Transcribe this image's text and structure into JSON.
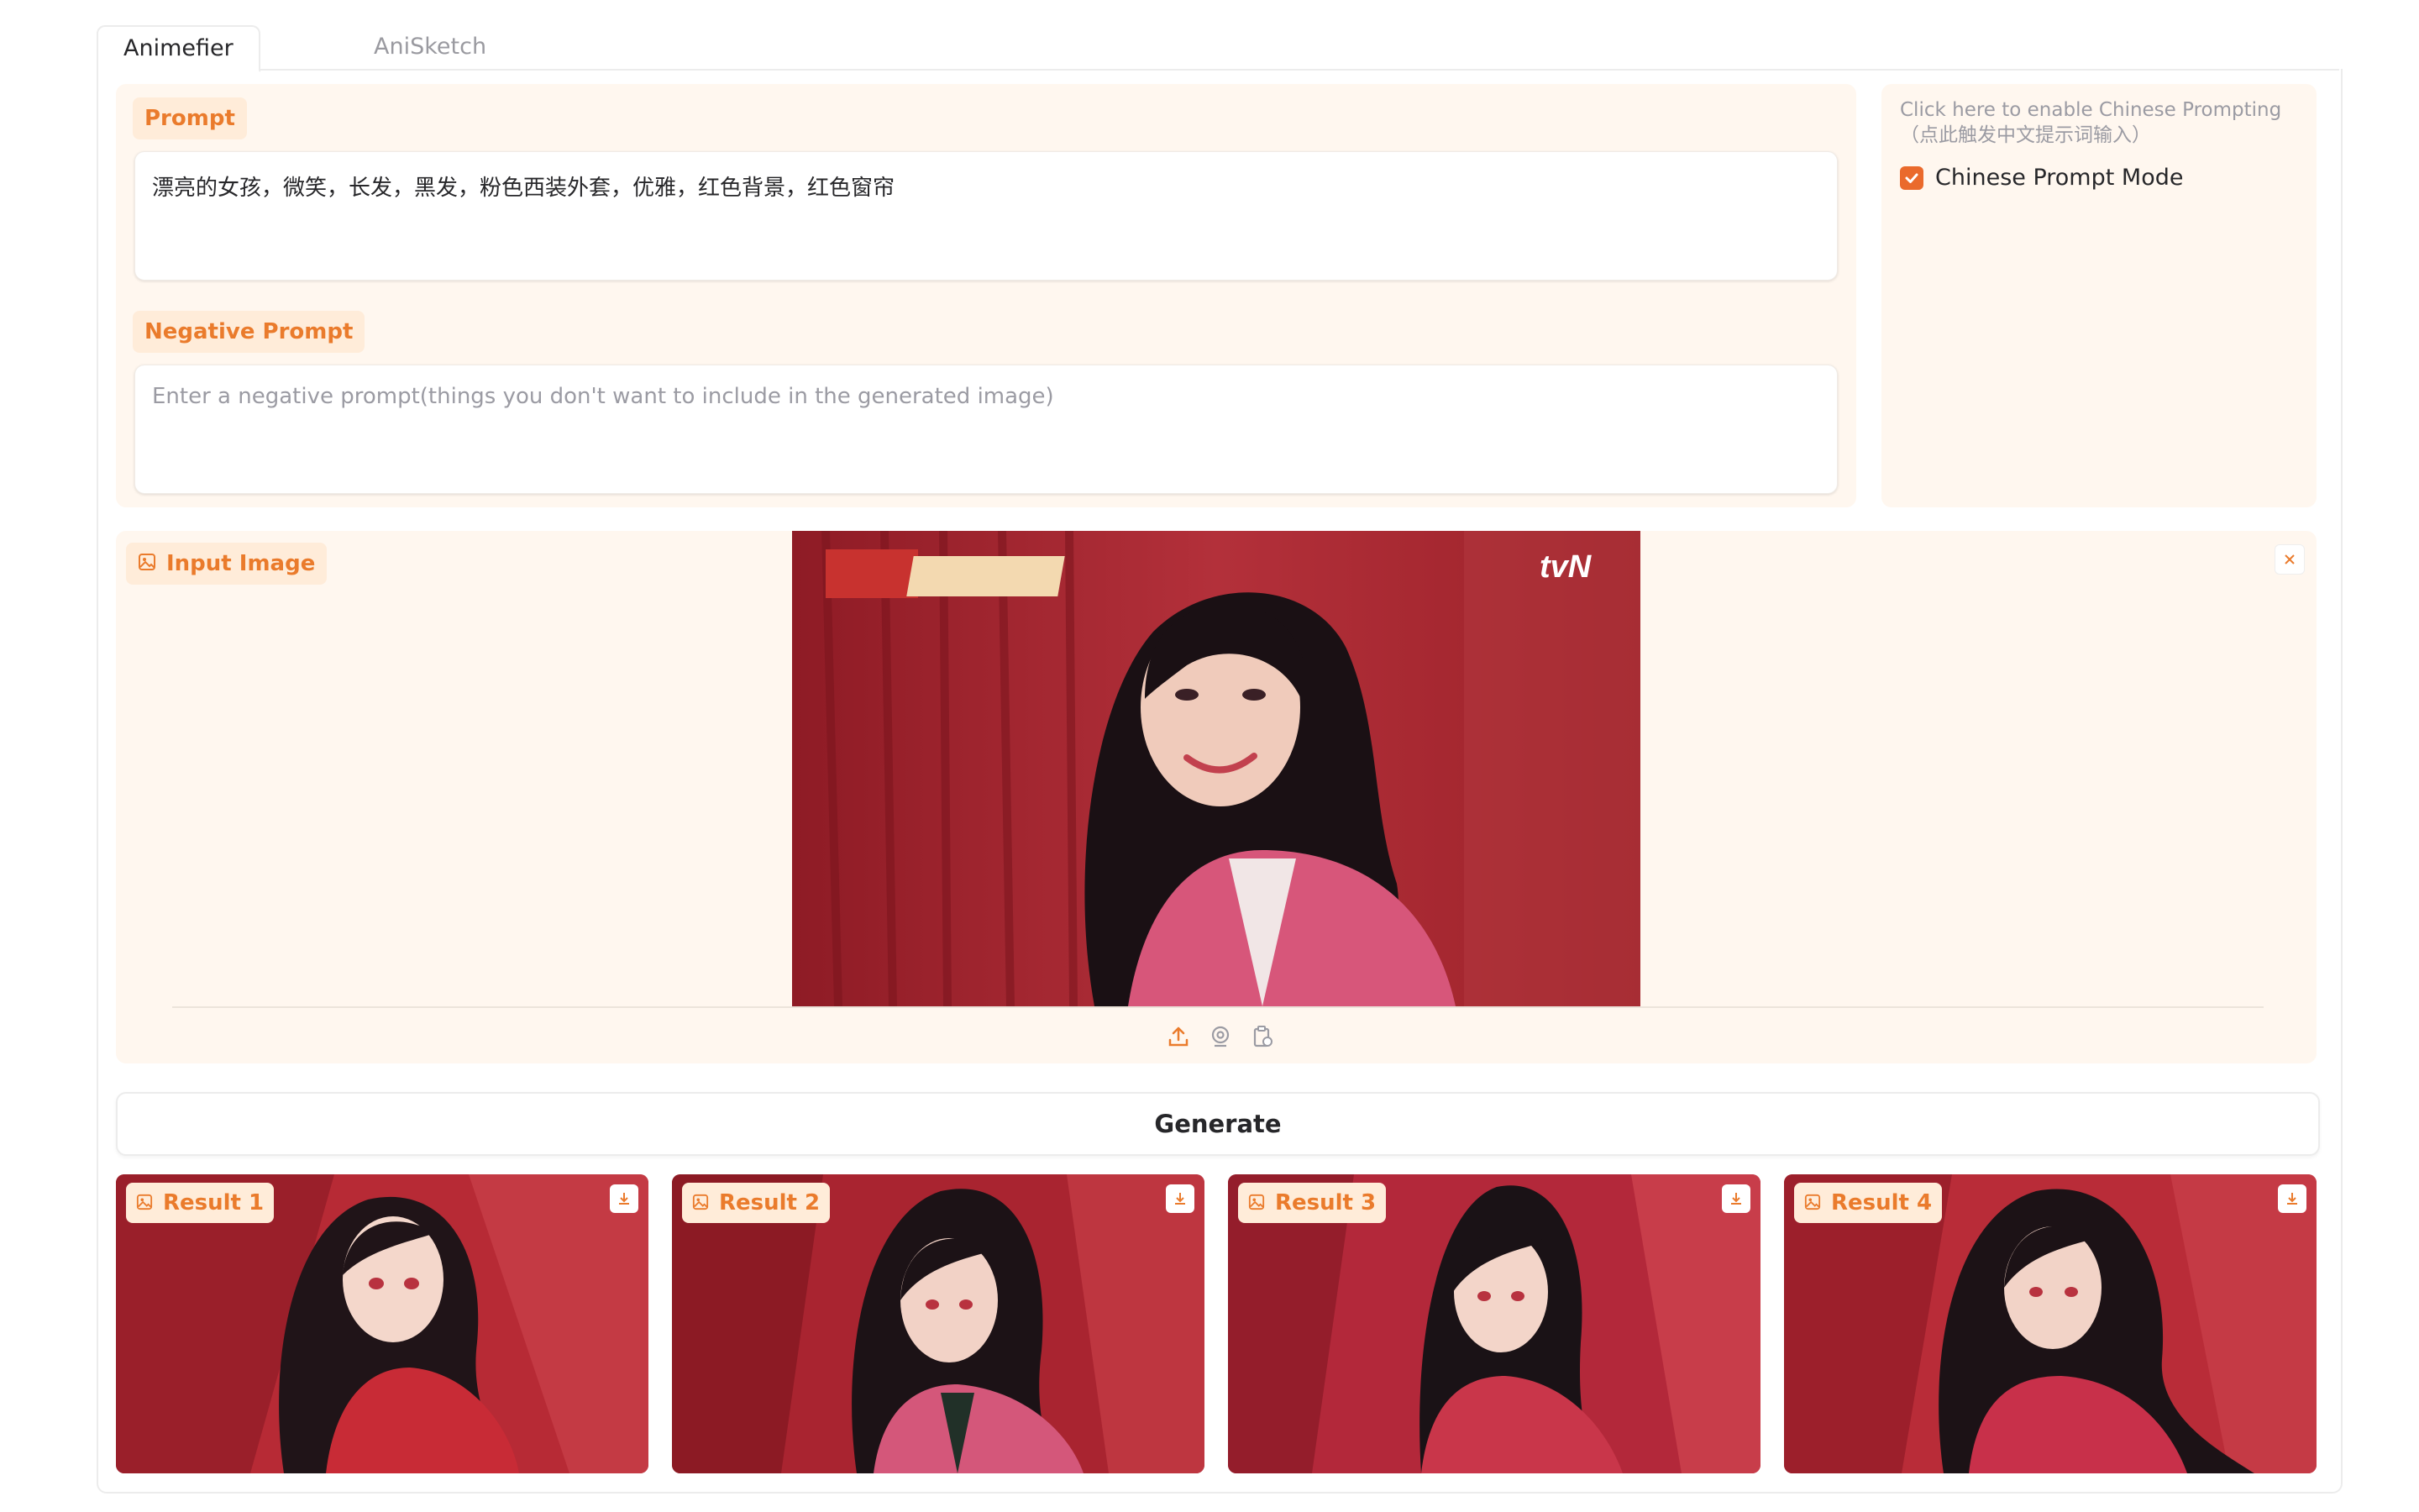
{
  "tabs": [
    {
      "label": "Animefier",
      "active": true
    },
    {
      "label": "AniSketch",
      "active": false
    }
  ],
  "prompt": {
    "label": "Prompt",
    "value": "漂亮的女孩，微笑，长发，黑发，粉色西装外套，优雅，红色背景，红色窗帘"
  },
  "negative_prompt": {
    "label": "Negative Prompt",
    "placeholder": "Enter a negative prompt(things you don't want to include in the generated image)"
  },
  "chinese_mode": {
    "hint_line1": "Click here to enable Chinese Prompting",
    "hint_line2": "（点此触发中文提示词输入）",
    "checkbox_label": "Chinese Prompt Mode",
    "checked": true
  },
  "input_image": {
    "label": "Input Image",
    "overlay_logo": "tvN"
  },
  "generate_label": "Generate",
  "results": [
    {
      "label": "Result 1"
    },
    {
      "label": "Result 2"
    },
    {
      "label": "Result 3"
    },
    {
      "label": "Result 4"
    }
  ],
  "colors": {
    "accent": "#ea7b2c",
    "panel_bg": "#fff7ef",
    "pill_bg": "#ffecd9"
  },
  "icons": {
    "image_label_icon": "image-icon",
    "upload": "upload-icon",
    "webcam": "webcam-icon",
    "clipboard": "clipboard-icon",
    "close": "close-icon",
    "download": "download-icon"
  }
}
